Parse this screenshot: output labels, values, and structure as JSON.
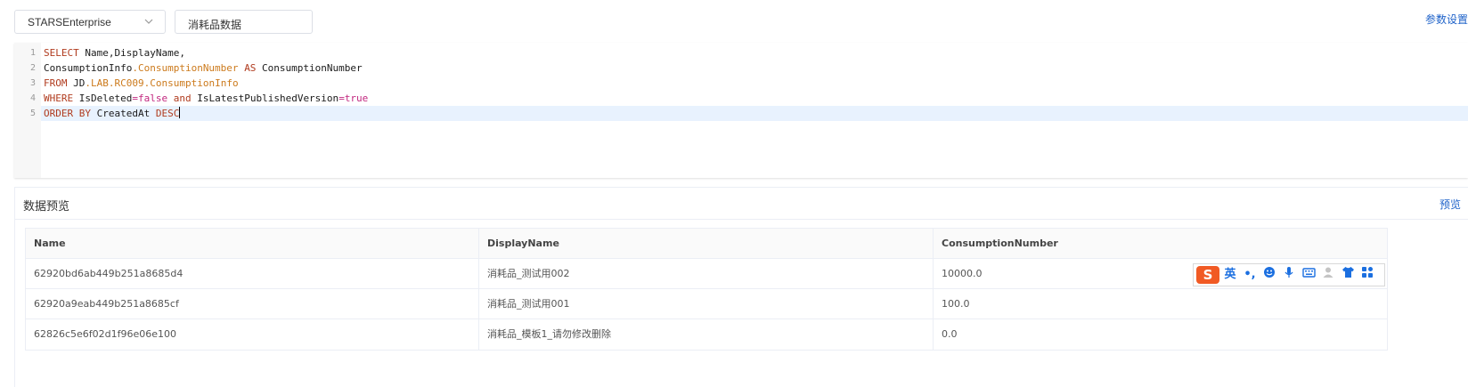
{
  "toolbar": {
    "datasource": "STARSEnterprise",
    "name_value": "消耗品数据",
    "param_settings": "参数设置"
  },
  "editor": {
    "line_numbers": [
      "1",
      "2",
      "3",
      "4",
      "5"
    ],
    "lines": [
      "SELECT Name,DisplayName,",
      "ConsumptionInfo.ConsumptionNumber AS ConsumptionNumber",
      "FROM JD.LAB.RC009.ConsumptionInfo",
      "WHERE IsDeleted=false and IsLatestPublishedVersion=true",
      "ORDER BY CreatedAt DESC"
    ],
    "active_line": 5
  },
  "preview": {
    "title": "数据预览",
    "action": "预览",
    "columns": [
      "Name",
      "DisplayName",
      "ConsumptionNumber"
    ],
    "rows": [
      [
        "62920bd6ab449b251a8685d4",
        "消耗品_测试用002",
        "10000.0"
      ],
      [
        "62920a9eab449b251a8685cf",
        "消耗品_测试用001",
        "100.0"
      ],
      [
        "62826c5e6f02d1f96e06e100",
        "消耗品_模板1_请勿修改删除",
        "0.0"
      ]
    ]
  },
  "ime": {
    "logo": "S",
    "lang": "英",
    "punct": "•,",
    "icons": [
      "emoji-icon",
      "mic-icon",
      "keyboard-icon",
      "user-icon",
      "skin-icon",
      "grid-icon"
    ]
  },
  "colors": {
    "link": "#1e62c9",
    "keyword": "#b03b1e",
    "property": "#cc7a1c",
    "boolean": "#c2277f",
    "active_line": "#e8f2fe",
    "ime_logo": "#f15a24",
    "ime_icon": "#1b6fe0"
  }
}
